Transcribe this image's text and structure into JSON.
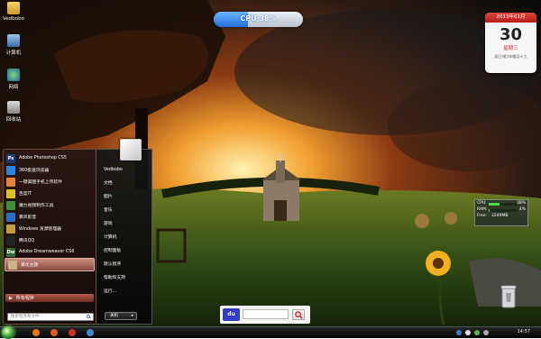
{
  "desktop_icons": [
    {
      "name": "user-folder-icon",
      "label": "Vedbobo"
    },
    {
      "name": "computer-icon",
      "label": "计算机"
    },
    {
      "name": "network-icon",
      "label": "网络"
    },
    {
      "name": "recycle-bin-icon",
      "label": "回收站"
    }
  ],
  "cpu_meter": {
    "label": "CPU",
    "percent_text": "38%",
    "percent": 38
  },
  "calendar": {
    "year_month": "2013年01月",
    "day": "30",
    "weekday": "星期三",
    "lunar": "癸巳(蛇)年腊月十九"
  },
  "sysmon": {
    "cpu_label": "CPU:",
    "cpu_value": "38%",
    "cpu_fraction": 0.38,
    "ram_label": "RAM:",
    "ram_value": "4%",
    "ram_fraction": 0.04,
    "free_label": "Free:",
    "free_value": "3249MB"
  },
  "start_menu": {
    "programs": [
      {
        "label": "Adobe Photoshop CS5",
        "icon": "photoshop-icon",
        "color": "#1a3d73",
        "glyph": "Ps"
      },
      {
        "label": "360极速浏览器",
        "icon": "browser-360-icon",
        "color": "#2a86e0",
        "glyph": ""
      },
      {
        "label": "一键美图手机上传软件",
        "icon": "meitu-icon",
        "color": "#e8803a",
        "glyph": ""
      },
      {
        "label": "百度IT",
        "icon": "colorful-icon",
        "color": "#e0c020",
        "glyph": ""
      },
      {
        "label": "魔力视频制作工具",
        "icon": "video-maker-icon",
        "color": "#3d8f3d",
        "glyph": ""
      },
      {
        "label": "暴风影音",
        "icon": "baofeng-icon",
        "color": "#2b6ec9",
        "glyph": ""
      },
      {
        "label": "Windows 资源管理器",
        "icon": "explorer-icon",
        "color": "#c49a3a",
        "glyph": ""
      },
      {
        "label": "腾讯QQ",
        "icon": "qq-icon",
        "color": "#222222",
        "glyph": ""
      },
      {
        "label": "Adobe Dreamweaver CS6",
        "icon": "dreamweaver-icon",
        "color": "#2f6e2f",
        "glyph": "Dw"
      },
      {
        "label": "美化主题",
        "icon": "theme-icon",
        "color": "#c7b58a",
        "glyph": ""
      }
    ],
    "all_programs": "所有程序",
    "search_placeholder": "搜索程序和文件",
    "places": [
      "Vedbobo",
      "文档",
      "图片",
      "音乐",
      "游戏",
      "计算机",
      "控制面板",
      "默认程序",
      "帮助和支持",
      "运行..."
    ],
    "shutdown": "关机"
  },
  "baidu": {
    "logo_text": "du"
  },
  "taskbar": {
    "time": "14:57"
  }
}
